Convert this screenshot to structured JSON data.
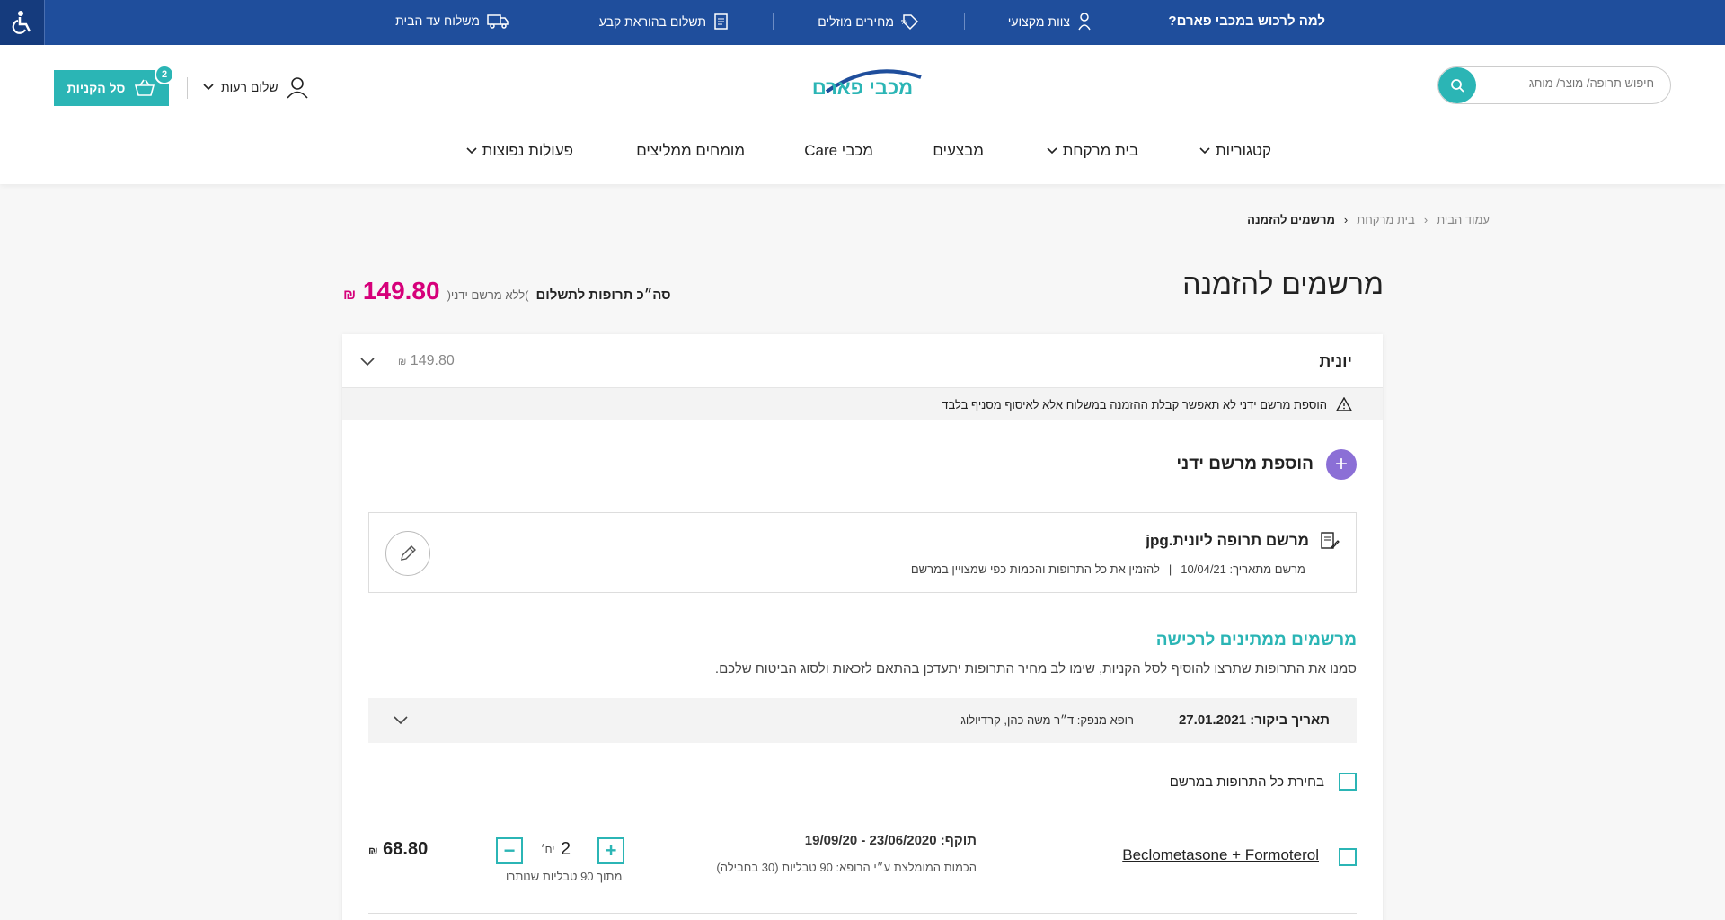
{
  "topbar": {
    "why_title": "למה לרכוש במכבי פארם?",
    "features": [
      {
        "label": "צוות מקצועי",
        "icon": "pharmacist-icon"
      },
      {
        "label": "מחירים מוזלים",
        "icon": "discount-tag-icon"
      },
      {
        "label": "תשלום בהוראת קבע",
        "icon": "invoice-icon"
      },
      {
        "label": "משלוח עד הבית",
        "icon": "delivery-truck-icon"
      }
    ],
    "accessibility_icon": "wheelchair-icon"
  },
  "header": {
    "search_placeholder": "חיפוש תרופה/ מוצר/ מותג",
    "logo_text": "מכבי פארם",
    "cart_label": "סל הקניות",
    "cart_count": "2",
    "user_greeting": "שלום רעות"
  },
  "nav": {
    "items": [
      {
        "label": "קטגוריות",
        "has_dropdown": true
      },
      {
        "label": "בית מרקחת",
        "has_dropdown": true
      },
      {
        "label": "מבצעים",
        "has_dropdown": false
      },
      {
        "label": "מכבי Care",
        "has_dropdown": false
      },
      {
        "label": "מומחים ממליצים",
        "has_dropdown": false
      },
      {
        "label": "פעולות נפוצות",
        "has_dropdown": true
      }
    ]
  },
  "breadcrumb": {
    "items": [
      "עמוד הבית",
      "בית מרקחת",
      "מרשמים להזמנה"
    ]
  },
  "page": {
    "title": "מרשמים להזמנה",
    "total_label": "סה״כ תרופות לתשלום",
    "total_note": ")ללא מרשם ידני(",
    "total_price": "149.80",
    "currency": "₪"
  },
  "patient": {
    "name": "יונית",
    "subtotal": "149.80",
    "warning": "הוספת מרשם ידני לא תאפשר קבלת ההזמנה במשלוח אלא לאיסוף מסניף בלבד",
    "add_manual_label": "הוספת מרשם ידני",
    "manual_rx": {
      "filename": "מרשם תרופה ליונית.jpg",
      "date_label": "מרשם מתאריך: 10/04/21",
      "note": "להזמין את כל התרופות והכמות כפי שמצויין במרשם"
    }
  },
  "pending": {
    "title": "מרשמים ממתינים לרכישה",
    "description": "סמנו את התרופות שתרצו להוסיף לסל הקניות, שימו לב מחיר התרופות יתעדכן בהתאם לזכאות ולסוג הביטוח שלכם.",
    "visit_date_label": "תאריך ביקור: 27.01.2021",
    "doctor": "רופא מנפק: ד״ר משה כהן, קרדיולוג",
    "select_all_label": "בחירת כל התרופות במרשם",
    "drug": {
      "name": "Beclometasone + Formoterol",
      "validity": "תוקף: 23/06/2020 - 19/09/20",
      "recommended": "הכמות המומלצת ע״י הרופא: 90 טבליות (30 בחבילה)",
      "quantity": "2",
      "unit": "יח׳",
      "remaining": "מתוך 90 טבליות שנותרו",
      "price": "68.80"
    }
  },
  "colors": {
    "brand_blue": "#1f4e9c",
    "teal": "#2bb5b5",
    "price_pink": "#d6007a",
    "purple": "#8b6fd6"
  }
}
